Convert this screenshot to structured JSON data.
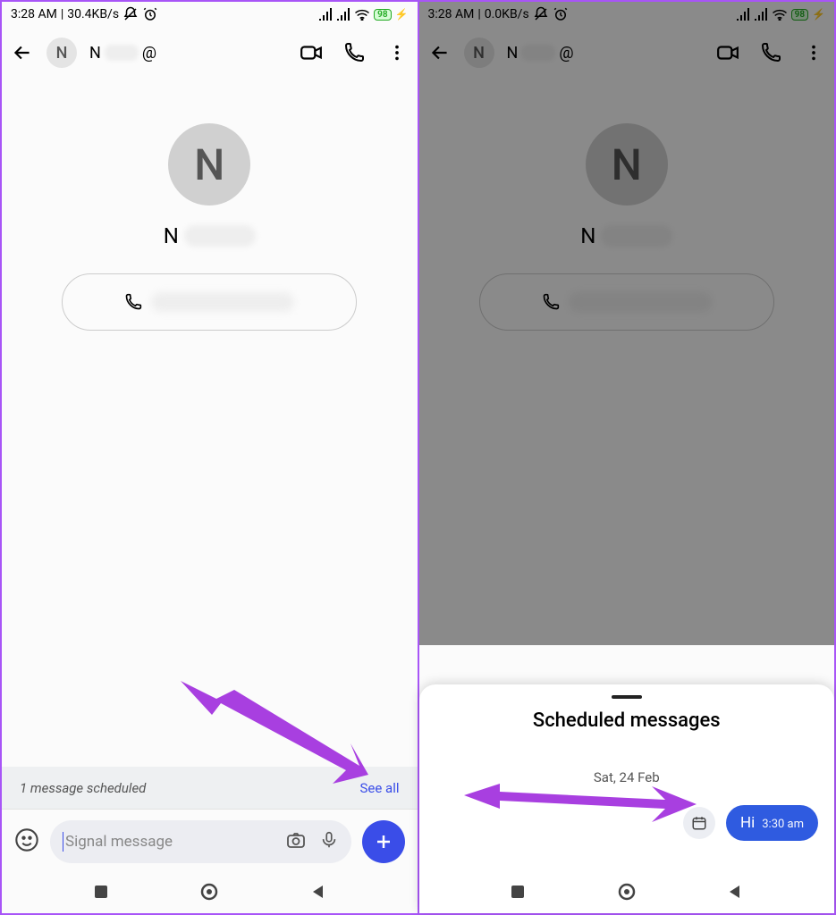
{
  "left": {
    "status": {
      "time": "3:28 AM",
      "speed": "30.4KB/s",
      "battery": "98"
    },
    "header": {
      "avatar_initial": "N",
      "name_initial": "N",
      "at_glyph": "@"
    },
    "profile": {
      "initial": "N",
      "name_initial": "N"
    },
    "banner": {
      "text": "1 message scheduled",
      "link": "See all"
    },
    "compose": {
      "placeholder": "Signal message"
    }
  },
  "right": {
    "status": {
      "time": "3:28 AM",
      "speed": "0.0KB/s",
      "battery": "98"
    },
    "header": {
      "avatar_initial": "N",
      "name_initial": "N",
      "at_glyph": "@"
    },
    "profile": {
      "initial": "N",
      "name_initial": "N"
    },
    "sheet": {
      "title": "Scheduled messages",
      "date": "Sat, 24 Feb",
      "message": "Hi",
      "time": "3:30 am"
    }
  }
}
